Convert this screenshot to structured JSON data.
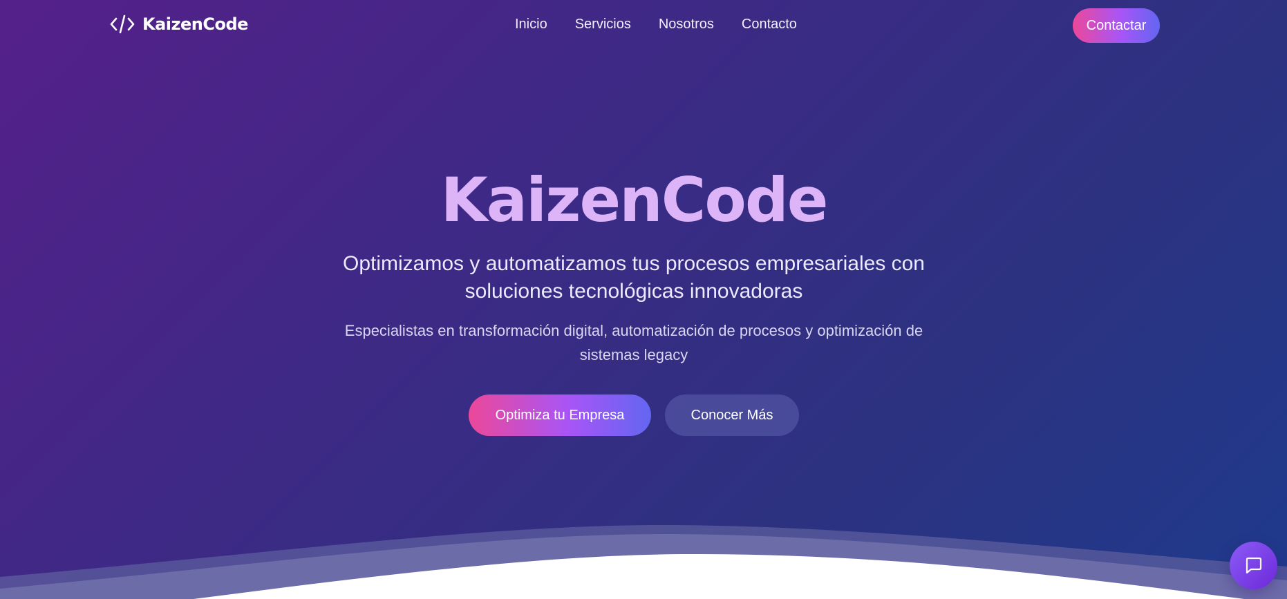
{
  "header": {
    "logo": {
      "icon": "code-brackets-icon",
      "text": "KaizenCode"
    },
    "nav": [
      {
        "label": "Inicio"
      },
      {
        "label": "Servicios"
      },
      {
        "label": "Nosotros"
      },
      {
        "label": "Contacto"
      }
    ],
    "cta_label": "Contactar"
  },
  "hero": {
    "title": "KaizenCode",
    "subtitle": "Optimizamos y automatizamos tus procesos empresariales con soluciones tecnológicas innovadoras",
    "description": "Especialistas en transformación digital, automatización de procesos y optimización de sistemas legacy",
    "primary_button": "Optimiza tu Empresa",
    "secondary_button": "Conocer Más"
  },
  "chat_widget": {
    "icon": "chat-bubble-icon"
  },
  "colors": {
    "background_start": "#55208a",
    "background_end": "#1f3a8c",
    "accent_gradient": [
      "#ec4899",
      "#a855f7",
      "#6366f1"
    ],
    "title": "#dcb4f7"
  }
}
